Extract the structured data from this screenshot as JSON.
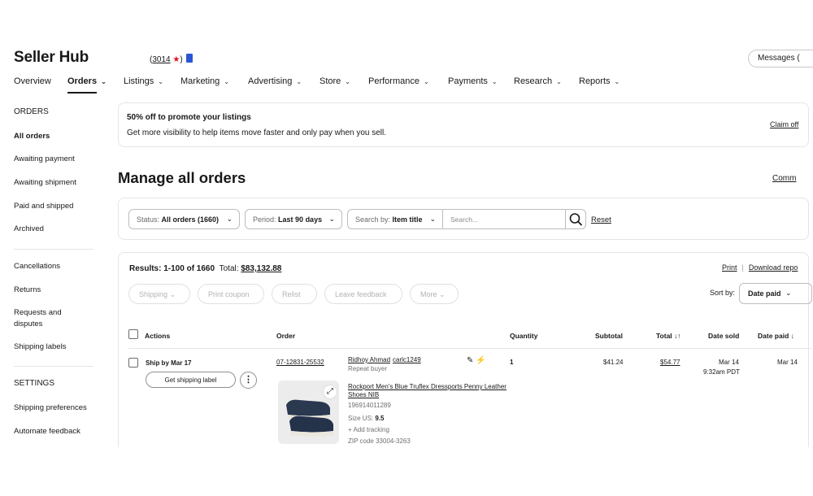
{
  "header": {
    "title": "Seller Hub",
    "feedback_score": "3014",
    "messages_label": "Messages ("
  },
  "nav": {
    "items": [
      {
        "label": "Overview",
        "has_chevron": false
      },
      {
        "label": "Orders",
        "has_chevron": true,
        "active": true
      },
      {
        "label": "Listings",
        "has_chevron": true
      },
      {
        "label": "Marketing",
        "has_chevron": true
      },
      {
        "label": "Advertising",
        "has_chevron": true
      },
      {
        "label": "Store",
        "has_chevron": true
      },
      {
        "label": "Performance",
        "has_chevron": true
      },
      {
        "label": "Payments",
        "has_chevron": true
      },
      {
        "label": "Research",
        "has_chevron": true
      },
      {
        "label": "Reports",
        "has_chevron": true
      }
    ]
  },
  "sidebar": {
    "orders_heading": "ORDERS",
    "orders_items": [
      "All orders",
      "Awaiting payment",
      "Awaiting shipment",
      "Paid and shipped",
      "Archived"
    ],
    "other_items": [
      "Cancellations",
      "Returns",
      "Requests and",
      "disputes",
      "Shipping labels"
    ],
    "settings_heading": "SETTINGS",
    "settings_items": [
      "Shipping preferences",
      "Automate feedback"
    ]
  },
  "promo": {
    "title": "50% off to promote your listings",
    "text": "Get more visibility to help items move faster and only pay when you sell.",
    "link": "Claim off"
  },
  "main": {
    "heading": "Manage all orders",
    "comm_link": "Comm"
  },
  "filters": {
    "status_label": "Status:",
    "status_value": "All orders (1660)",
    "period_label": "Period:",
    "period_value": "Last 90 days",
    "searchby_label": "Search by:",
    "searchby_value": "Item title",
    "search_placeholder": "Search...",
    "reset": "Reset"
  },
  "results": {
    "range": "Results: 1-100 of 1660",
    "total_label": "Total:",
    "total_value": "$83,132.88",
    "print": "Print",
    "download": "Download repo",
    "sort_label": "Sort by:",
    "sort_value": "Date paid"
  },
  "actions": [
    "Shipping",
    "Print coupon",
    "Relist",
    "Leave feedback",
    "More"
  ],
  "table": {
    "headers": {
      "actions": "Actions",
      "order": "Order",
      "quantity": "Quantity",
      "subtotal": "Subtotal",
      "total": "Total ↓↑",
      "date_sold": "Date sold",
      "date_paid": "Date paid ↓"
    },
    "row": {
      "ship_by": "Ship by Mar 17",
      "ship_button": "Get shipping label",
      "order_number": "07-12831-25532",
      "buyer_name": "Ridhoy Ahmad",
      "buyer_id": "carlc1249",
      "buyer_type": "Repeat buyer",
      "item_title_1": "Rockport Men's Blue Truflex Dressports Penny Leather",
      "item_title_2": "Shoes NIB",
      "item_number": "196914011289",
      "size_label": "Size US:",
      "size_value": "9.5",
      "add_tracking": "+ Add tracking",
      "zip": "ZIP code 33004-3263",
      "quantity": "1",
      "subtotal": "$41.24",
      "total": "$54.77",
      "date_sold": "Mar 14",
      "time_sold": "9:32am PDT",
      "date_paid": "Mar 14"
    }
  }
}
